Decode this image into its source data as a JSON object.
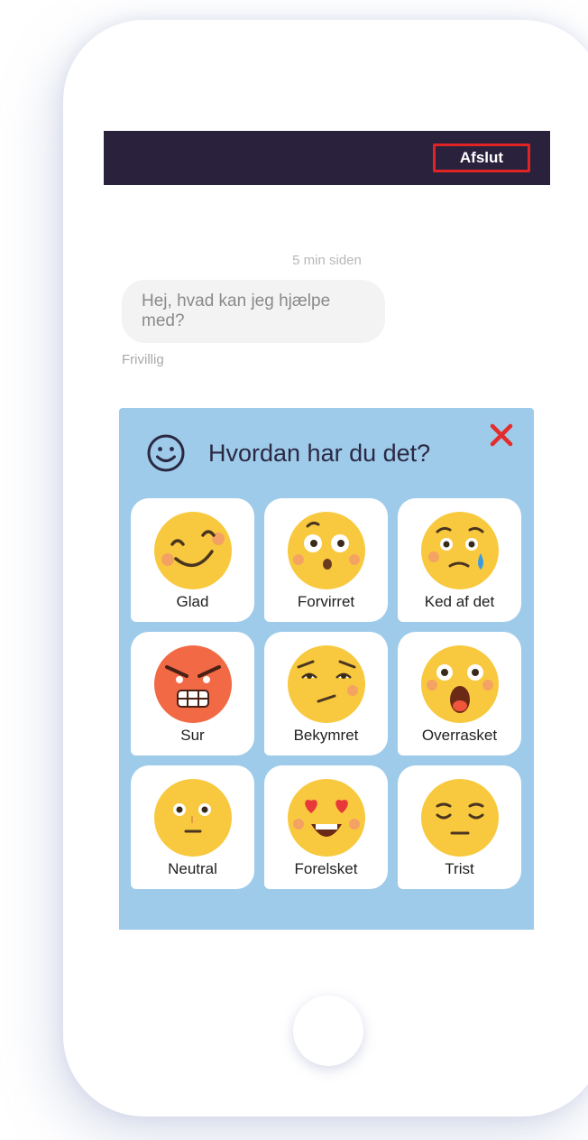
{
  "header": {
    "end_button_label": "Afslut"
  },
  "chat": {
    "timestamp": "5 min siden",
    "message": "Hej, hvad kan jeg hjælpe med?",
    "sender": "Frivillig"
  },
  "mood_modal": {
    "title": "Hvordan har du det?",
    "header_icon": "smiley-outline-icon",
    "close_icon": "close-icon",
    "moods": [
      {
        "label": "Glad",
        "icon": "happy-face-icon"
      },
      {
        "label": "Forvirret",
        "icon": "confused-face-icon"
      },
      {
        "label": "Ked af det",
        "icon": "crying-face-icon"
      },
      {
        "label": "Sur",
        "icon": "angry-face-icon"
      },
      {
        "label": "Bekymret",
        "icon": "worried-face-icon"
      },
      {
        "label": "Overrasket",
        "icon": "surprised-face-icon"
      },
      {
        "label": "Neutral",
        "icon": "neutral-face-icon"
      },
      {
        "label": "Forelsket",
        "icon": "heart-eyes-face-icon"
      },
      {
        "label": "Trist",
        "icon": "sad-face-icon"
      }
    ]
  },
  "colors": {
    "top_bar": "#2a223d",
    "end_button_border": "#e02424",
    "modal_background": "#9ecbea",
    "emoji_yellow": "#f8c93e",
    "emoji_angry": "#f26a45"
  }
}
